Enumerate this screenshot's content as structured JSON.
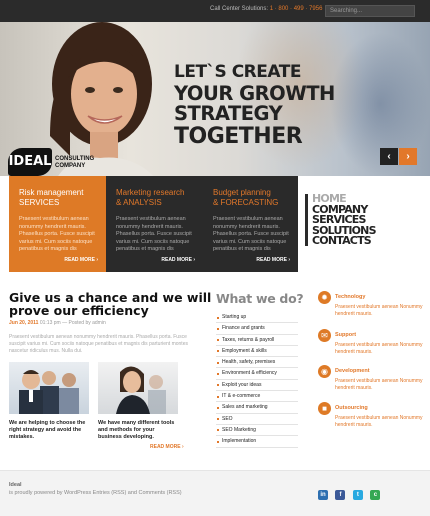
{
  "topbar": {
    "call_label": "Call Center Solutions:",
    "phone": "1 · 800 · 499 · 7956",
    "search_placeholder": "Searching..."
  },
  "hero": {
    "headline_1": "LET`S CREATE",
    "headline_2": "YOUR GROWTH STRATEGY",
    "headline_3": "TOGETHER",
    "logo_badge": "IDEAL",
    "logo_line_1": "CONSULTING",
    "logo_line_2": "COMPANY",
    "prev_label": "‹",
    "next_label": "›"
  },
  "features": [
    {
      "title_1": "Risk management",
      "title_2": "SERVICES",
      "text": "Praesent vestibulum aenean nonummy hendrerit mauris. Phasellus porta. Fusce suscipit varius mi. Cum sociis natoque penatibus et magnis dis",
      "more": "READ MORE"
    },
    {
      "title_1": "Marketing research",
      "title_2": "& ANALYSIS",
      "text": "Praesent vestibulum aenean nonummy hendrerit mauris. Phasellus porta. Fusce suscipit varius mi. Cum sociis natoque penatibus et magnis dis",
      "more": "READ MORE"
    },
    {
      "title_1": "Budget planning",
      "title_2": "& FORECASTING",
      "text": "Praesent vestibulum aenean nonummy hendrerit mauris. Phasellus porta. Fusce suscipit varius mi. Cum sociis natoque penatibus et magnis dis",
      "more": "READ MORE"
    }
  ],
  "sidenav": [
    "HOME",
    "COMPANY",
    "SERVICES",
    "SOLUTIONS",
    "CONTACTS"
  ],
  "post": {
    "heading_1": "Give us a chance and we will",
    "heading_2": "prove our efficiency",
    "date": "Jun 20, 2011",
    "time": "01:13 pm",
    "by": "— Posted by admin",
    "text": "Praesent vestibulum aenean nonummy hendrerit mauris. Phasellus porta. Fusce suscipit varius mi. Cum sociis natoque penatibus et magnis dis parturient montes nascetur ridiculus mus. Nulla dui.",
    "caption_1": "We are helping to choose the right strategy and avoid the mistakes.",
    "caption_2": "We have many different tools and methods for your business developing.",
    "more": "READ MORE"
  },
  "whatdo": {
    "title": "What we do?",
    "items": [
      "Starting up",
      "Finance and grants",
      "Taxes, returns & payroll",
      "Employment & skills",
      "Health, safety, premises",
      "Environment & efficiency",
      "Exploit your ideas",
      "IT & e-commerce",
      "Sales and marketing",
      "SEO",
      "SEO Marketing",
      "Implementation"
    ]
  },
  "services": [
    {
      "title": "Technology",
      "text": "Praesent vestibulum aenean Nonummy hendrerit mauris.",
      "icon": "gear-icon"
    },
    {
      "title": "Support",
      "text": "Praesent vestibulum aenean Nonummy hendrerit mauris.",
      "icon": "chat-icon"
    },
    {
      "title": "Development",
      "text": "Praesent vestibulum aenean Nonummy hendrerit mauris.",
      "icon": "globe-icon"
    },
    {
      "title": "Outsourcing",
      "text": "Praesent vestibulum aenean Nonummy hendrerit mauris.",
      "icon": "box-icon"
    }
  ],
  "footer": {
    "name": "Ideal",
    "text": "is proudly powered by WordPress  Entries (RSS) and Comments (RSS)",
    "social": [
      "in",
      "f",
      "t",
      "c"
    ]
  },
  "colors": {
    "accent": "#de7a26",
    "dark": "#2a2a2a"
  }
}
